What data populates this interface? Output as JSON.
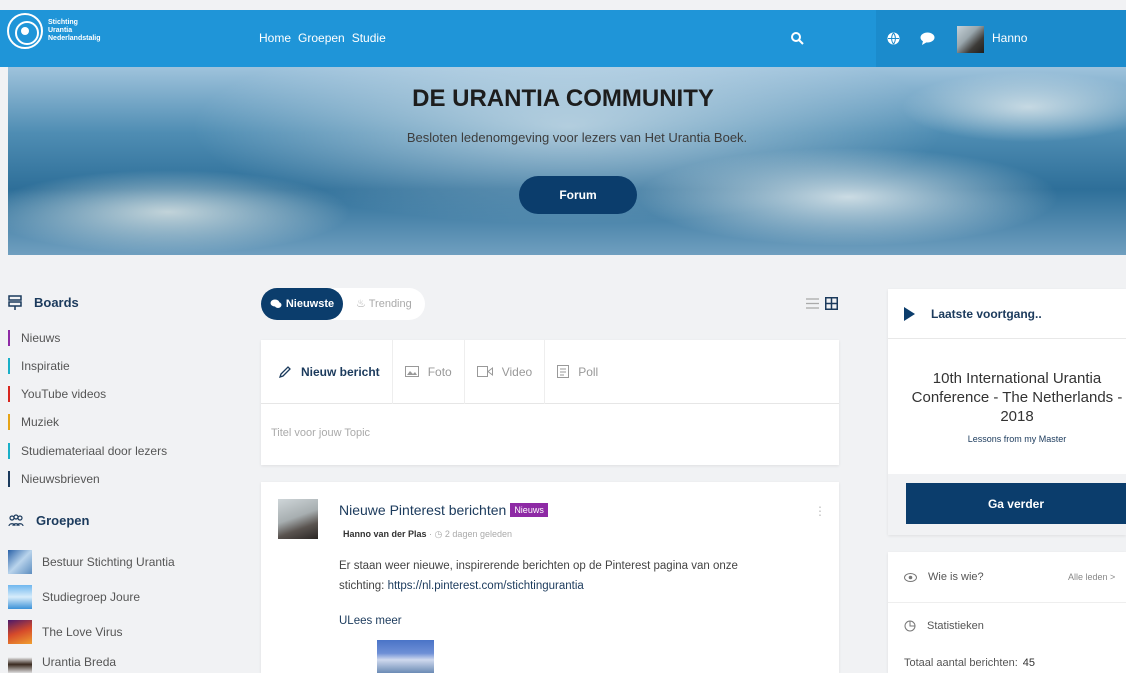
{
  "brand": {
    "line1": "Stichting",
    "line2": "Urantia",
    "line3": "Nederlandstalig"
  },
  "nav": {
    "items": [
      "Home",
      "Groepen",
      "Studie"
    ]
  },
  "user": {
    "name": "Hanno"
  },
  "hero": {
    "title": "DE URANTIA COMMUNITY",
    "subtitle": "Besloten ledenomgeving voor lezers van Het Urantia Boek.",
    "button": "Forum"
  },
  "sidebar": {
    "boards_title": "Boards",
    "boards": [
      {
        "label": "Nieuws",
        "color": "#8e2aa5"
      },
      {
        "label": "Inspiratie",
        "color": "#1ab0c8"
      },
      {
        "label": "YouTube videos",
        "color": "#d8261f"
      },
      {
        "label": "Muziek",
        "color": "#e6a417"
      },
      {
        "label": "Studiemateriaal door lezers",
        "color": "#1ab0c8"
      },
      {
        "label": "Nieuwsbrieven",
        "color": "#1b3a5c"
      }
    ],
    "groups_title": "Groepen",
    "groups": [
      {
        "label": "Bestuur Stichting Urantia"
      },
      {
        "label": "Studiegroep Joure"
      },
      {
        "label": "The Love Virus"
      },
      {
        "label": "Urantia Breda"
      }
    ]
  },
  "feed": {
    "tab_newest": "Nieuwste",
    "tab_trending": "Trending",
    "composer": {
      "tabs": [
        "Nieuw bericht",
        "Foto",
        "Video",
        "Poll"
      ],
      "placeholder": "Titel voor jouw Topic"
    },
    "post": {
      "title": "Nieuwe Pinterest berichten",
      "badge": "Nieuws",
      "author": "Hanno van der Plas",
      "time": "2 dagen geleden",
      "body": "Er staan weer nieuwe, inspirerende berichten op de Pinterest pagina van onze stichting: ",
      "link": "https://nl.pinterest.com/stichtingurantia",
      "read_more": "ULees meer"
    }
  },
  "right": {
    "progress_title": "Laatste voortgang..",
    "conference_title": "10th International Urantia Conference - The Netherlands - 2018",
    "conference_sub": "Lessons from my Master",
    "continue_button": "Ga verder",
    "who_title": "Wie is wie?",
    "all_members": "Alle leden >",
    "stats_title": "Statistieken",
    "total_posts_label": "Totaal aantal berichten:",
    "total_posts_value": "45"
  }
}
